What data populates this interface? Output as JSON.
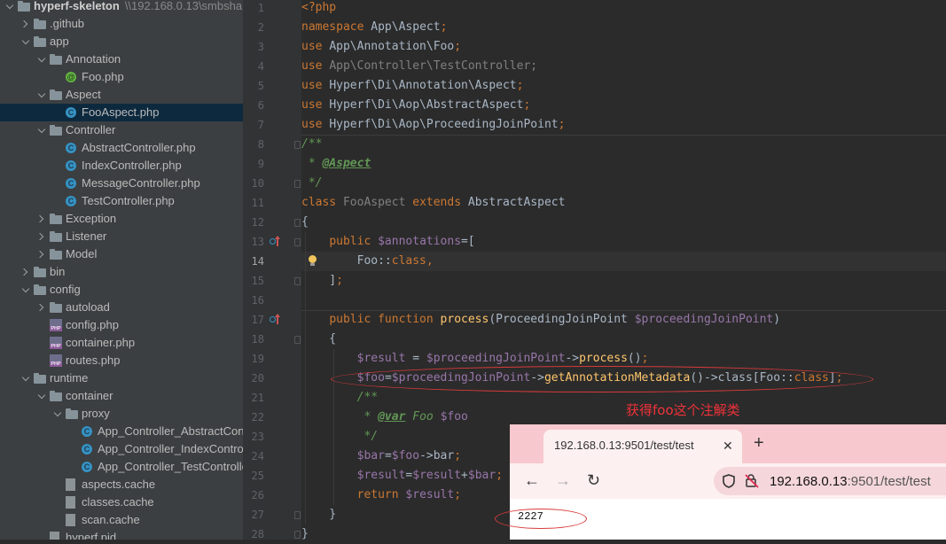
{
  "tree": {
    "root_name": "hyperf-skeleton",
    "root_path": "\\\\192.168.0.13\\smbsha",
    "items": [
      {
        "label": "hyperf-skeleton",
        "type": "folder",
        "depth": 0,
        "state": "open"
      },
      {
        "label": ".github",
        "type": "folder",
        "depth": 1,
        "state": "closed"
      },
      {
        "label": "app",
        "type": "folder",
        "depth": 1,
        "state": "open"
      },
      {
        "label": "Annotation",
        "type": "folder",
        "depth": 2,
        "state": "open"
      },
      {
        "label": "Foo.php",
        "type": "annotation",
        "depth": 3,
        "state": "none"
      },
      {
        "label": "Aspect",
        "type": "folder",
        "depth": 2,
        "state": "open"
      },
      {
        "label": "FooAspect.php",
        "type": "class",
        "depth": 3,
        "state": "none",
        "selected": true
      },
      {
        "label": "Controller",
        "type": "folder",
        "depth": 2,
        "state": "open"
      },
      {
        "label": "AbstractController.php",
        "type": "class",
        "depth": 3,
        "state": "none"
      },
      {
        "label": "IndexController.php",
        "type": "class",
        "depth": 3,
        "state": "none"
      },
      {
        "label": "MessageController.php",
        "type": "class",
        "depth": 3,
        "state": "none"
      },
      {
        "label": "TestController.php",
        "type": "class",
        "depth": 3,
        "state": "none"
      },
      {
        "label": "Exception",
        "type": "folder",
        "depth": 2,
        "state": "closed"
      },
      {
        "label": "Listener",
        "type": "folder",
        "depth": 2,
        "state": "closed"
      },
      {
        "label": "Model",
        "type": "folder",
        "depth": 2,
        "state": "closed"
      },
      {
        "label": "bin",
        "type": "folder",
        "depth": 1,
        "state": "closed"
      },
      {
        "label": "config",
        "type": "folder",
        "depth": 1,
        "state": "open"
      },
      {
        "label": "autoload",
        "type": "folder",
        "depth": 2,
        "state": "closed"
      },
      {
        "label": "config.php",
        "type": "php",
        "depth": 2,
        "state": "none"
      },
      {
        "label": "container.php",
        "type": "php",
        "depth": 2,
        "state": "none"
      },
      {
        "label": "routes.php",
        "type": "php",
        "depth": 2,
        "state": "none"
      },
      {
        "label": "runtime",
        "type": "folder",
        "depth": 1,
        "state": "open"
      },
      {
        "label": "container",
        "type": "folder",
        "depth": 2,
        "state": "open"
      },
      {
        "label": "proxy",
        "type": "folder",
        "depth": 3,
        "state": "open"
      },
      {
        "label": "App_Controller_AbstractCont",
        "type": "class",
        "depth": 4,
        "state": "none"
      },
      {
        "label": "App_Controller_IndexContro",
        "type": "class",
        "depth": 4,
        "state": "none"
      },
      {
        "label": "App_Controller_TestControlle",
        "type": "class",
        "depth": 4,
        "state": "none"
      },
      {
        "label": "aspects.cache",
        "type": "file",
        "depth": 3,
        "state": "none"
      },
      {
        "label": "classes.cache",
        "type": "file",
        "depth": 3,
        "state": "none"
      },
      {
        "label": "scan.cache",
        "type": "file",
        "depth": 3,
        "state": "none"
      },
      {
        "label": "hyperf.pid",
        "type": "file",
        "depth": 2,
        "state": "none"
      }
    ]
  },
  "editor": {
    "current_line": 14,
    "lines": [
      {
        "n": 1,
        "tokens": [
          [
            "kw",
            "<?php"
          ]
        ]
      },
      {
        "n": 2,
        "tokens": [
          [
            "kw",
            "namespace "
          ],
          [
            "",
            "App\\Aspect"
          ],
          [
            "kw",
            ";"
          ]
        ]
      },
      {
        "n": 3,
        "tokens": [
          [
            "kw",
            "use "
          ],
          [
            "",
            "App\\Annotation\\Foo"
          ],
          [
            "kw",
            ";"
          ]
        ]
      },
      {
        "n": 4,
        "tokens": [
          [
            "kw",
            "use "
          ],
          [
            "gr",
            "App\\Controller\\TestController"
          ],
          [
            "gr",
            ";"
          ]
        ]
      },
      {
        "n": 5,
        "tokens": [
          [
            "kw",
            "use "
          ],
          [
            "",
            "Hyperf\\Di\\Annotation\\Aspect"
          ],
          [
            "kw",
            ";"
          ]
        ]
      },
      {
        "n": 6,
        "tokens": [
          [
            "kw",
            "use "
          ],
          [
            "",
            "Hyperf\\Di\\Aop\\AbstractAspect"
          ],
          [
            "kw",
            ";"
          ]
        ]
      },
      {
        "n": 7,
        "tokens": [
          [
            "kw",
            "use "
          ],
          [
            "",
            "Hyperf\\Di\\Aop\\ProceedingJoinPoint"
          ],
          [
            "kw",
            ";"
          ]
        ]
      },
      {
        "n": 8,
        "tokens": [
          [
            "cm",
            "/**"
          ]
        ]
      },
      {
        "n": 9,
        "tokens": [
          [
            "cm",
            " * "
          ],
          [
            "tag",
            "@Aspect"
          ]
        ]
      },
      {
        "n": 10,
        "tokens": [
          [
            "cm",
            " */"
          ]
        ]
      },
      {
        "n": 11,
        "tokens": [
          [
            "kw",
            "class "
          ],
          [
            "gr",
            "FooAspect "
          ],
          [
            "kw",
            "extends "
          ],
          [
            "",
            "AbstractAspect"
          ]
        ]
      },
      {
        "n": 12,
        "tokens": [
          [
            "",
            "{"
          ]
        ]
      },
      {
        "n": 13,
        "tokens": [
          [
            "",
            "    "
          ],
          [
            "kw",
            "public "
          ],
          [
            "var",
            "$annotations"
          ],
          [
            "",
            "=["
          ]
        ]
      },
      {
        "n": 14,
        "tokens": [
          [
            "",
            "        Foo::"
          ],
          [
            "kw",
            "class"
          ],
          [
            "kw",
            ","
          ]
        ]
      },
      {
        "n": 15,
        "tokens": [
          [
            "",
            "    ]"
          ],
          [
            "kw",
            ";"
          ]
        ]
      },
      {
        "n": 16,
        "tokens": [
          [
            "",
            ""
          ]
        ]
      },
      {
        "n": 17,
        "tokens": [
          [
            "",
            "    "
          ],
          [
            "kw",
            "public function "
          ],
          [
            "fn",
            "process"
          ],
          [
            "",
            "(ProceedingJoinPoint "
          ],
          [
            "var",
            "$proceedingJoinPoint"
          ],
          [
            "",
            ")"
          ]
        ]
      },
      {
        "n": 18,
        "tokens": [
          [
            "",
            "    {"
          ]
        ]
      },
      {
        "n": 19,
        "tokens": [
          [
            "",
            "        "
          ],
          [
            "var",
            "$result"
          ],
          [
            "",
            " = "
          ],
          [
            "var",
            "$proceedingJoinPoint"
          ],
          [
            "",
            "->"
          ],
          [
            "fn",
            "process"
          ],
          [
            "",
            "()"
          ],
          [
            "kw",
            ";"
          ]
        ]
      },
      {
        "n": 20,
        "tokens": [
          [
            "",
            "        "
          ],
          [
            "var",
            "$foo"
          ],
          [
            "",
            "="
          ],
          [
            "var",
            "$proceedingJoinPoint"
          ],
          [
            "",
            "->"
          ],
          [
            "fn",
            "getAnnotationMetadata"
          ],
          [
            "",
            "()->class[Foo::"
          ],
          [
            "kw",
            "class"
          ],
          [
            "",
            "]"
          ],
          [
            "kw",
            ";"
          ]
        ]
      },
      {
        "n": 21,
        "tokens": [
          [
            "",
            "        "
          ],
          [
            "cm",
            "/**"
          ]
        ]
      },
      {
        "n": 22,
        "tokens": [
          [
            "",
            "        "
          ],
          [
            "cm",
            " * "
          ],
          [
            "tag",
            "@var"
          ],
          [
            "cm",
            " Foo "
          ],
          [
            "var",
            "$foo"
          ]
        ]
      },
      {
        "n": 23,
        "tokens": [
          [
            "",
            "        "
          ],
          [
            "cm",
            " */"
          ]
        ]
      },
      {
        "n": 24,
        "tokens": [
          [
            "",
            "        "
          ],
          [
            "var",
            "$bar"
          ],
          [
            "",
            "="
          ],
          [
            "var",
            "$foo"
          ],
          [
            "",
            "->bar"
          ],
          [
            "kw",
            ";"
          ]
        ]
      },
      {
        "n": 25,
        "tokens": [
          [
            "",
            "        "
          ],
          [
            "var",
            "$result"
          ],
          [
            "",
            "="
          ],
          [
            "var",
            "$result"
          ],
          [
            "",
            "+"
          ],
          [
            "var",
            "$bar"
          ],
          [
            "kw",
            ";"
          ]
        ]
      },
      {
        "n": 26,
        "tokens": [
          [
            "",
            "        "
          ],
          [
            "kw",
            "return "
          ],
          [
            "var",
            "$result"
          ],
          [
            "kw",
            ";"
          ]
        ]
      },
      {
        "n": 27,
        "tokens": [
          [
            "",
            "    }"
          ]
        ]
      },
      {
        "n": 28,
        "tokens": [
          [
            "",
            "}"
          ]
        ]
      }
    ],
    "annotation_note": "获得foo这个注解类"
  },
  "browser": {
    "tab_title": "192.168.0.13:9501/test/test",
    "close_glyph": "✕",
    "new_tab_glyph": "+",
    "back_glyph": "←",
    "forward_glyph": "→",
    "reload_glyph": "↻",
    "address_host": "192.168.0.13",
    "address_rest": ":9501/test/test",
    "result": "2227"
  },
  "colors": {
    "tree_bg": "#3c3f41",
    "editor_bg": "#2b2b2b",
    "keyword": "#cc7832",
    "variable": "#9876aa",
    "function": "#ffc66d",
    "comment": "#629755",
    "annotation_red": "#f0323a",
    "browser_tab_strip": "#f7c9cf"
  }
}
